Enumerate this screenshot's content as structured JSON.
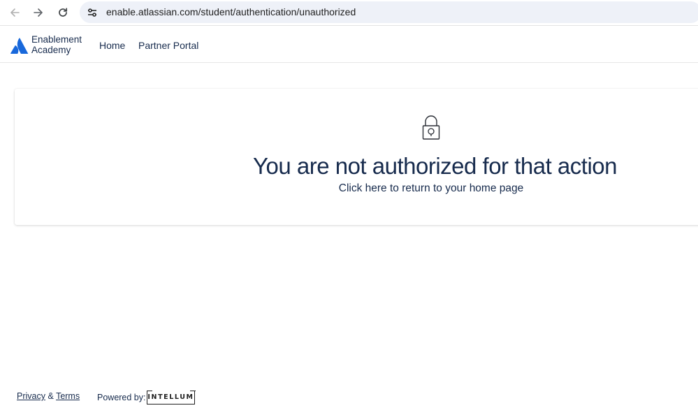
{
  "browser": {
    "url": "enable.atlassian.com/student/authentication/unauthorized",
    "back_icon": "arrow-left-icon",
    "forward_icon": "arrow-right-icon",
    "reload_icon": "reload-icon",
    "site_info_icon": "tune-icon"
  },
  "header": {
    "logo_line1": "Enablement",
    "logo_line2": "Academy",
    "nav": [
      {
        "label": "Home"
      },
      {
        "label": "Partner Portal"
      }
    ]
  },
  "main": {
    "icon": "lock-icon",
    "title": "You are not authorized for that action",
    "link_text": "Click here to return to your home page"
  },
  "footer": {
    "privacy_label": "Privacy",
    "ampersand": "&",
    "terms_label": "Terms",
    "powered_by_label": "Powered by:",
    "brand_badge": "INTELLUM"
  },
  "colors": {
    "text": "#172b4d",
    "atlassian_blue": "#1868db",
    "url_bar_bg": "#eef1f8"
  }
}
